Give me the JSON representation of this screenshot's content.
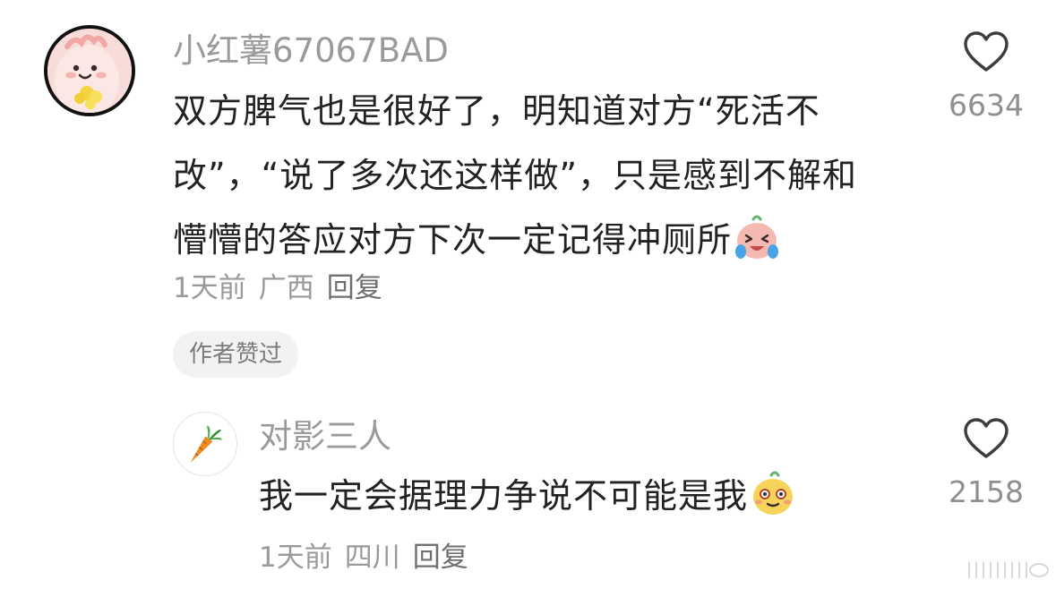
{
  "comment": {
    "username": "小红薯67067BAD",
    "body_lines": [
      "双方脾气也是很好了，明知道对方“死活不",
      "改”，“说了多次还这样做”，只是感到不解和",
      "懵懵的答应对方下次一定记得冲厕所"
    ],
    "emoji": "crying-laugh-emoji",
    "time": "1天前",
    "location": "广西",
    "reply_label": "回复",
    "badge": "作者赞过",
    "likes": "6634"
  },
  "reply": {
    "username": "对影三人",
    "body": "我一定会据理力争说不可能是我",
    "emoji": "sly-face-emoji",
    "time": "1天前",
    "location": "四川",
    "reply_label": "回复",
    "likes": "2158"
  },
  "icons": {
    "like": "heart-icon",
    "avatar_reply": "carrot-icon"
  },
  "colors": {
    "muted_text": "#9a9a9a",
    "body_text": "#222222",
    "badge_bg": "#f2f2f2"
  }
}
